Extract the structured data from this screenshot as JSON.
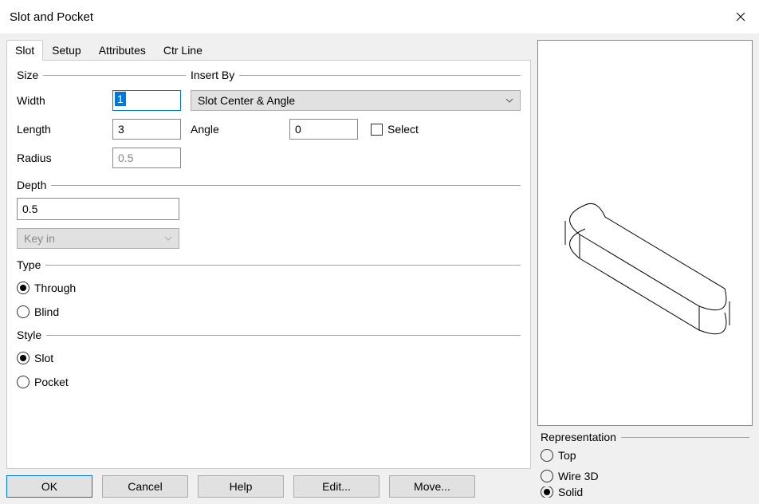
{
  "titlebar": {
    "title": "Slot and Pocket"
  },
  "tabs": {
    "slot": "Slot",
    "setup": "Setup",
    "attributes": "Attributes",
    "ctrline": "Ctr Line"
  },
  "size": {
    "legend": "Size",
    "width_label": "Width",
    "width_value": "1",
    "length_label": "Length",
    "length_value": "3",
    "radius_label": "Radius",
    "radius_value": "0.5"
  },
  "insert_by": {
    "legend": "Insert By",
    "selected": "Slot Center & Angle",
    "angle_label": "Angle",
    "angle_value": "0",
    "select_label": "Select"
  },
  "depth": {
    "legend": "Depth",
    "value": "0.5",
    "mode": "Key in"
  },
  "type": {
    "legend": "Type",
    "through": "Through",
    "blind": "Blind"
  },
  "style": {
    "legend": "Style",
    "slot": "Slot",
    "pocket": "Pocket"
  },
  "buttons": {
    "ok": "OK",
    "cancel": "Cancel",
    "help": "Help",
    "edit": "Edit...",
    "move": "Move..."
  },
  "representation": {
    "legend": "Representation",
    "top": "Top",
    "wire3d": "Wire 3D",
    "solid": "Solid"
  }
}
